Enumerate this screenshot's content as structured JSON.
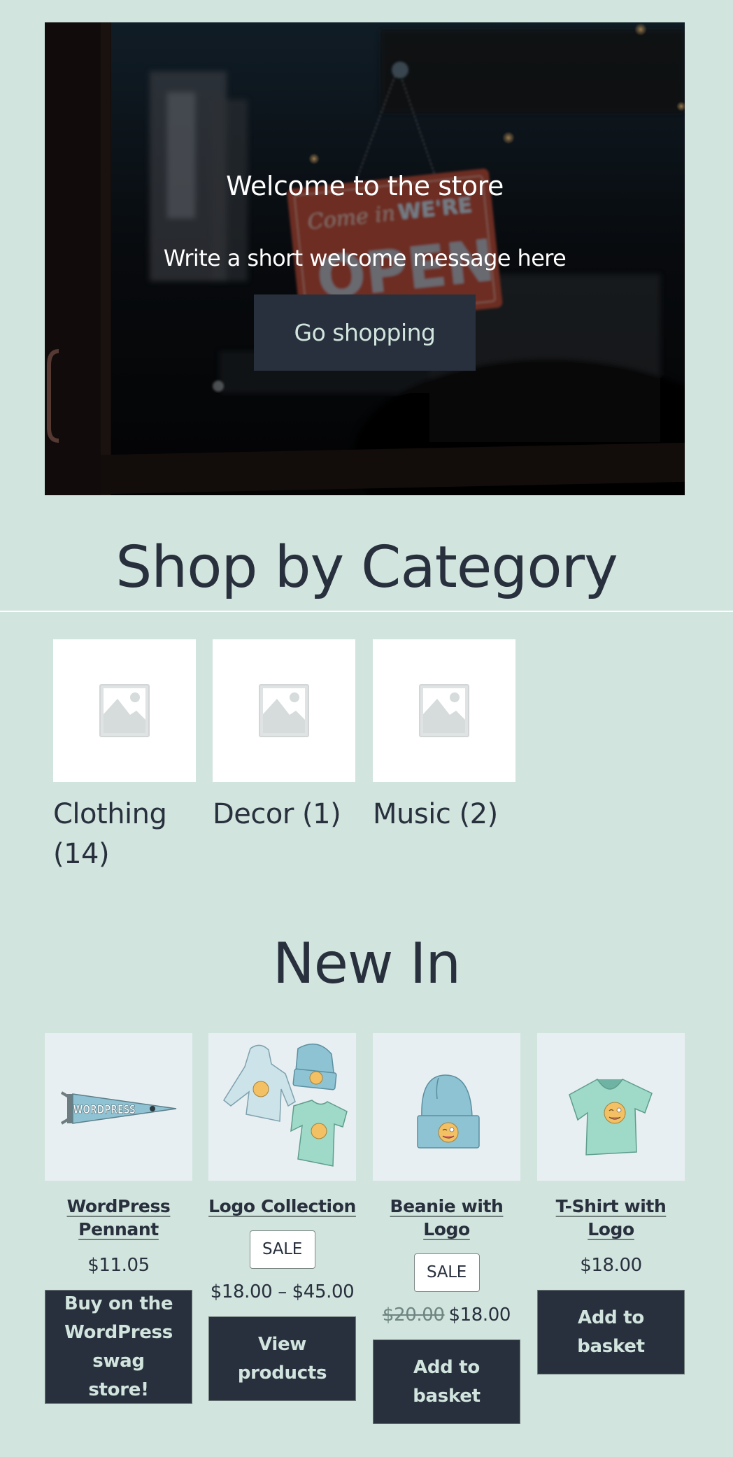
{
  "hero": {
    "title": "Welcome to the store",
    "subtitle": "Write a short welcome message here",
    "button_label": "Go shopping",
    "image": "store-open-sign-photo"
  },
  "categories_section": {
    "heading": "Shop by Category",
    "items": [
      {
        "label": "Clothing (14)",
        "icon": "image-placeholder-icon"
      },
      {
        "label": "Decor (1)",
        "icon": "image-placeholder-icon"
      },
      {
        "label": "Music (2)",
        "icon": "image-placeholder-icon"
      }
    ]
  },
  "new_in_section": {
    "heading": "New In",
    "products": [
      {
        "title": "WordPress Pennant",
        "image": "pennant",
        "sale": false,
        "price": "$11.05",
        "old_price": null,
        "button": "Buy on the WordPress swag store!"
      },
      {
        "title": "Logo Collection",
        "image": "logo-collection",
        "sale": true,
        "sale_label": "SALE",
        "price": "$18.00 – $45.00",
        "old_price": null,
        "button": "View products"
      },
      {
        "title": "Beanie with Logo",
        "image": "beanie",
        "sale": true,
        "sale_label": "SALE",
        "price": "$18.00",
        "old_price": "$20.00",
        "button": "Add to basket"
      },
      {
        "title": "T-Shirt with Logo",
        "image": "tshirt",
        "sale": false,
        "price": "$18.00",
        "old_price": null,
        "button": "Add to basket"
      }
    ]
  },
  "colors": {
    "background": "#d1e4dd",
    "text": "#28303d",
    "button_bg": "#28303d",
    "button_text": "#d1e4dd",
    "product_image_bg": "#e8eff2"
  }
}
